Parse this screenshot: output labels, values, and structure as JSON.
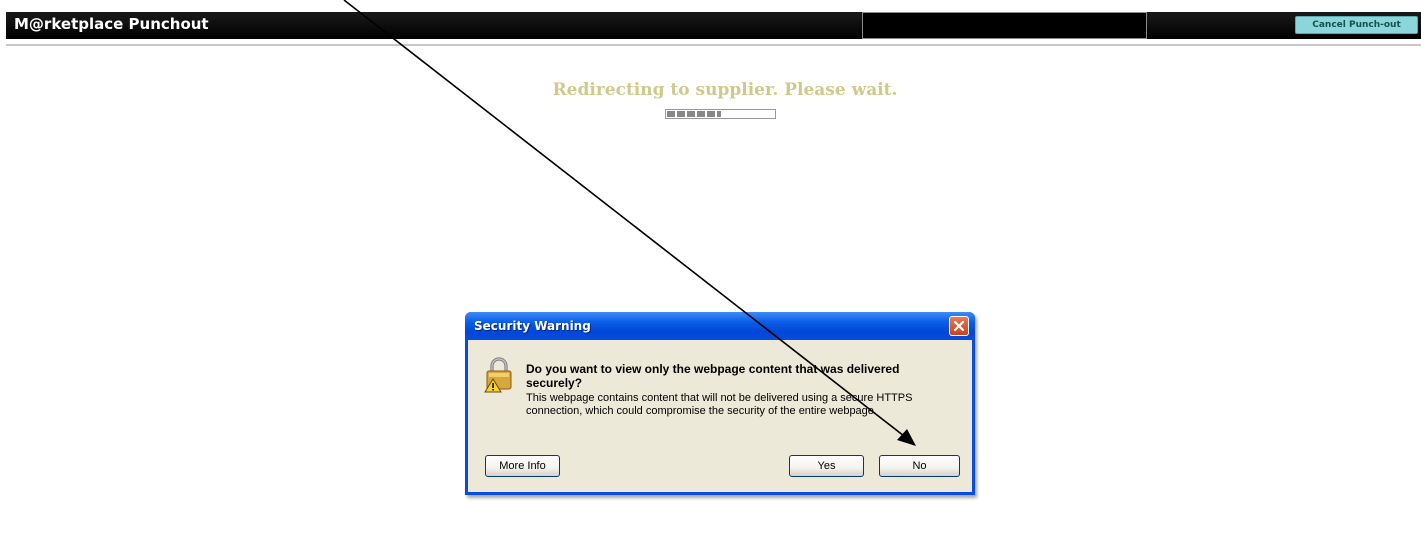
{
  "header": {
    "title": "M@rketplace Punchout",
    "cancel_label": "Cancel Punch-out"
  },
  "status": {
    "message": "Redirecting to supplier. Please wait.",
    "progress": 0.5
  },
  "dialog": {
    "title": "Security Warning",
    "heading": "Do you want to view only the webpage content that was delivered securely?",
    "body": "This webpage contains content that will not be delivered using a secure HTTPS connection, which could compromise the security of the entire webpage.",
    "buttons": {
      "more_info": "More Info",
      "yes": "Yes",
      "no": "No"
    }
  },
  "icons": {
    "dialog": "padlock-warning-icon",
    "close": "close-icon"
  },
  "colors": {
    "header_bg": "#000000",
    "cancel_button": "#8ad6da",
    "redirect_text": "#cfc98c",
    "titlebar": "#0a4be0",
    "dialog_body": "#ece9d8",
    "close_button": "#c9421a"
  }
}
